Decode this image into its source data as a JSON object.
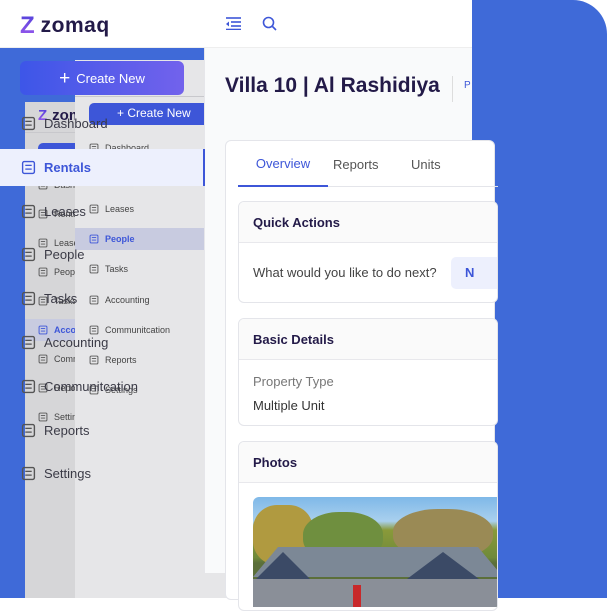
{
  "brand": {
    "name": "zomaq",
    "accent": "#3d56d8",
    "background": "#3f6ad8"
  },
  "header": {
    "collapse_icon": "menu-collapse-icon",
    "search_icon": "search-icon"
  },
  "create_button": {
    "label": "Create New",
    "icon": "plus-icon"
  },
  "sidebar": {
    "items": [
      {
        "label": "Dashboard",
        "icon": "dashboard-icon"
      },
      {
        "label": "Rentals",
        "icon": "building-icon"
      },
      {
        "label": "Leases",
        "icon": "lease-icon"
      },
      {
        "label": "People",
        "icon": "people-icon"
      },
      {
        "label": "Tasks",
        "icon": "clipboard-icon"
      },
      {
        "label": "Accounting",
        "icon": "accounting-icon"
      },
      {
        "label": "Communitcation",
        "icon": "megaphone-icon"
      },
      {
        "label": "Reports",
        "icon": "report-icon"
      },
      {
        "label": "Settings",
        "icon": "gear-icon"
      }
    ],
    "active_front": "Rentals",
    "active_middle": "People",
    "active_back": "Accounting"
  },
  "page": {
    "title": "Villa 10 | Al Rashidiya",
    "title_extra": "P",
    "tabs": [
      {
        "label": "Overview",
        "active": true
      },
      {
        "label": "Reports"
      },
      {
        "label": "Units"
      }
    ],
    "quick_actions": {
      "title": "Quick Actions",
      "prompt": "What would you like to do next?",
      "button_partial": "N"
    },
    "basic_details": {
      "title": "Basic Details",
      "field_label": "Property Type",
      "field_value": "Multiple Unit"
    },
    "photos": {
      "title": "Photos"
    }
  }
}
